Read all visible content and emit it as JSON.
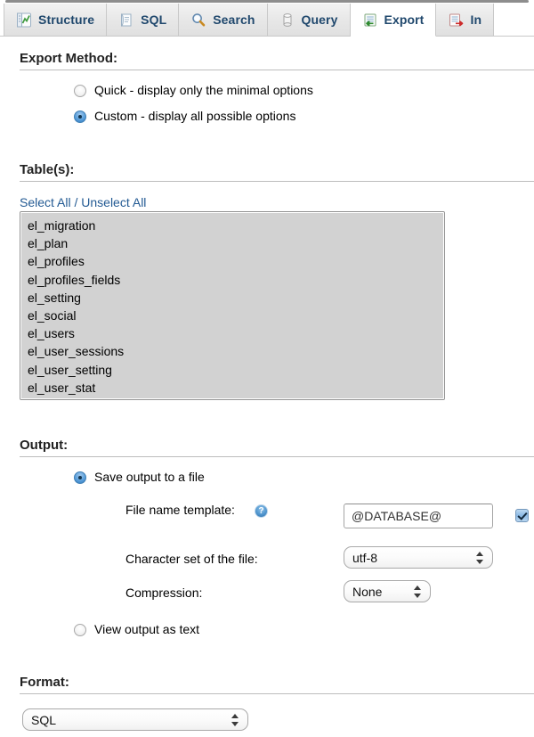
{
  "tabs": [
    {
      "label": "Structure",
      "icon": "structure-icon",
      "active": false
    },
    {
      "label": "SQL",
      "icon": "sql-icon",
      "active": false
    },
    {
      "label": "Search",
      "icon": "search-icon",
      "active": false
    },
    {
      "label": "Query",
      "icon": "query-icon",
      "active": false
    },
    {
      "label": "Export",
      "icon": "export-icon",
      "active": true
    },
    {
      "label": "In",
      "icon": "import-icon",
      "active": false
    }
  ],
  "export_method": {
    "title": "Export Method:",
    "options": [
      {
        "label": "Quick - display only the minimal options",
        "selected": false
      },
      {
        "label": "Custom - display all possible options",
        "selected": true
      }
    ]
  },
  "tables": {
    "title": "Table(s):",
    "select_all_label": "Select All",
    "separator": "/",
    "unselect_all_label": "Unselect All",
    "items": [
      "el_migration",
      "el_plan",
      "el_profiles",
      "el_profiles_fields",
      "el_setting",
      "el_social",
      "el_users",
      "el_user_sessions",
      "el_user_setting",
      "el_user_stat"
    ]
  },
  "output": {
    "title": "Output:",
    "save_to_file_label": "Save output to a file",
    "save_to_file_selected": true,
    "file_name_template_label": "File name template:",
    "file_name_template_value": "@DATABASE@",
    "file_name_template_placeholder": "@DATABASE@",
    "help_icon_glyph": "?",
    "remember_template_checked": true,
    "charset_label": "Character set of the file:",
    "charset_value": "utf-8",
    "compression_label": "Compression:",
    "compression_value": "None",
    "view_as_text_label": "View output as text",
    "view_as_text_selected": false
  },
  "format": {
    "title": "Format:",
    "value": "SQL"
  },
  "colors": {
    "tab_text": "#20486d",
    "link": "#235a93",
    "accent_blue": "#5b9fda",
    "listbox_bg": "#d2d2d2"
  }
}
